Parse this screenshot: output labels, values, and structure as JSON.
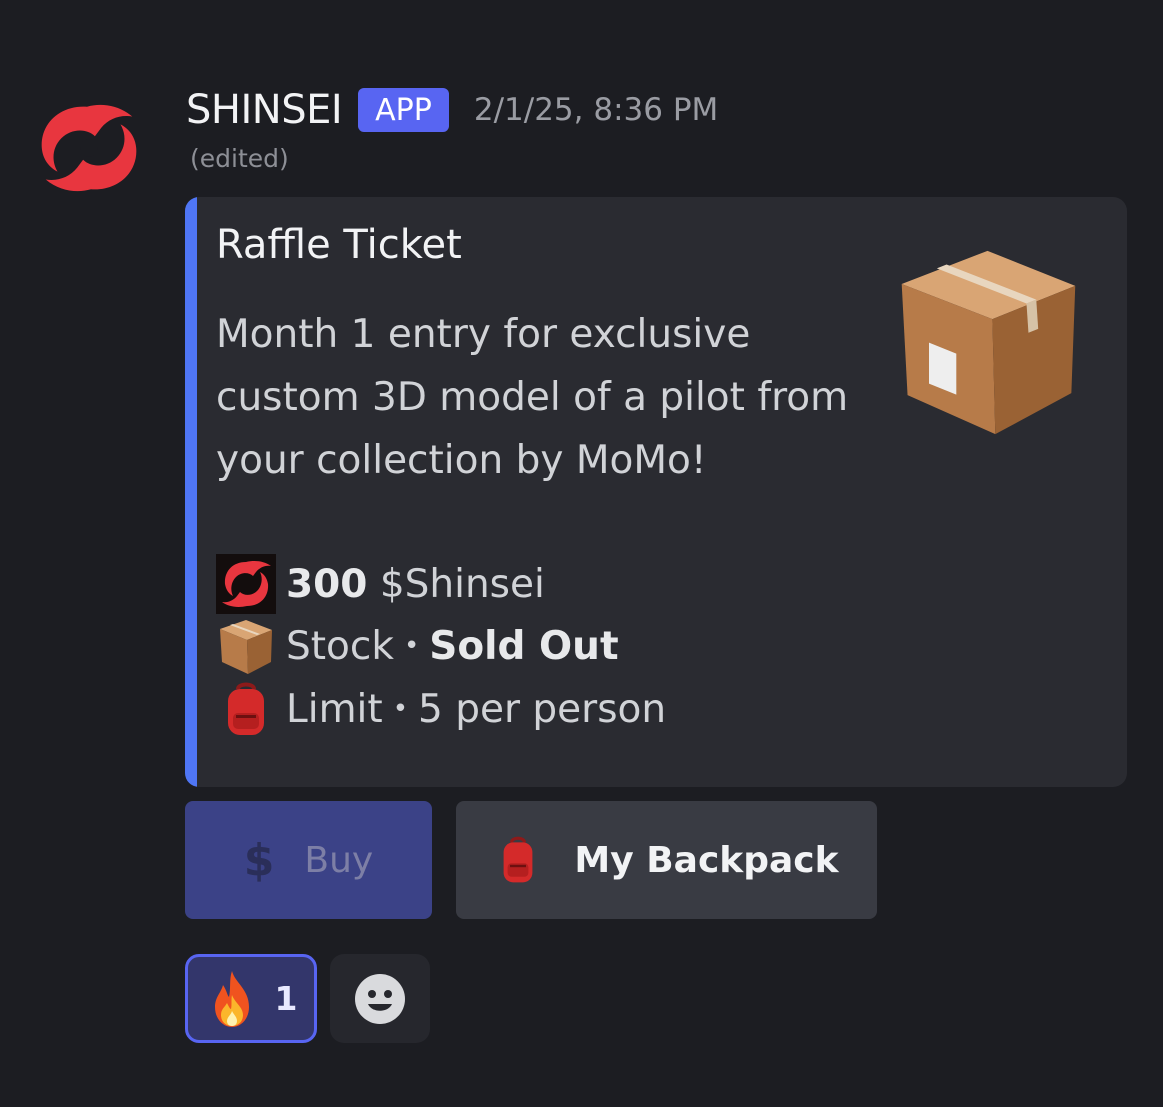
{
  "message": {
    "username": "SHINSEI",
    "badge": "APP",
    "timestamp": "2/1/25, 8:36 PM",
    "edited": "(edited)"
  },
  "embed": {
    "title": "Raffle Ticket",
    "description": "Month 1 entry for exclusive custom 3D model of a pilot from your collection by MoMo!",
    "accent_color": "#4f76f5",
    "fields": {
      "price_amount": "300",
      "price_currency": "$Shinsei",
      "stock_label": "Stock",
      "stock_value": "Sold Out",
      "limit_label": "Limit",
      "limit_value": "5 per person",
      "separator": "•"
    }
  },
  "buttons": {
    "buy_label": "Buy",
    "buy_icon": "$",
    "backpack_label": "My Backpack"
  },
  "reactions": {
    "fire_count": "1"
  },
  "icons": [
    "shinsei-logo-icon",
    "package-icon",
    "backpack-icon",
    "fire-icon",
    "add-reaction-icon"
  ]
}
